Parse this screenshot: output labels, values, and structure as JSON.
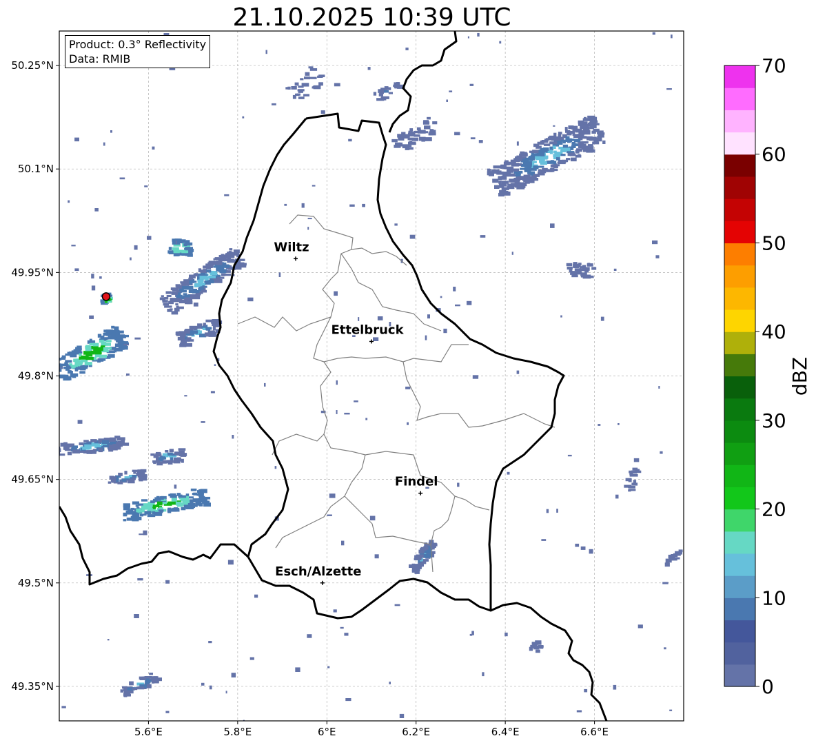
{
  "title": "21.10.2025 10:39 UTC",
  "info_box": {
    "product": "Product: 0.3° Reflectivity",
    "data": "Data: RMIB"
  },
  "map": {
    "lon_range": [
      5.4,
      6.8
    ],
    "lat_range": [
      49.3,
      50.3
    ],
    "x_ticks": [
      "5.6°E",
      "5.8°E",
      "6°E",
      "6.2°E",
      "6.4°E",
      "6.6°E"
    ],
    "x_tick_values": [
      5.6,
      5.8,
      6.0,
      6.2,
      6.4,
      6.6
    ],
    "y_ticks": [
      "49.35°N",
      "49.5°N",
      "49.65°N",
      "49.8°N",
      "49.95°N",
      "50.1°N",
      "50.25°N"
    ],
    "y_tick_values": [
      49.35,
      49.5,
      49.65,
      49.8,
      49.95,
      50.1,
      50.25
    ],
    "gridlines": true
  },
  "cities": [
    {
      "name": "Wiltz",
      "lon": 5.93,
      "lat": 49.97
    },
    {
      "name": "Ettelbruck",
      "lon": 6.1,
      "lat": 49.85
    },
    {
      "name": "Findel",
      "lon": 6.21,
      "lat": 49.63
    },
    {
      "name": "Esch/Alzette",
      "lon": 5.99,
      "lat": 49.5
    }
  ],
  "radar_site": {
    "lon": 5.505,
    "lat": 49.915
  },
  "colorbar": {
    "label": "dBZ",
    "ticks": [
      "0",
      "10",
      "20",
      "30",
      "40",
      "50",
      "60",
      "70"
    ],
    "tick_values": [
      0,
      10,
      20,
      30,
      40,
      50,
      60,
      70
    ],
    "colors": [
      "#6473a8",
      "#51629e",
      "#44579b",
      "#4a78b0",
      "#5b9dc8",
      "#66c0db",
      "#66d8c4",
      "#3fd66a",
      "#12c71a",
      "#11b616",
      "#109f12",
      "#0c8b10",
      "#0a7a0f",
      "#09600b",
      "#467a0a",
      "#afb00a",
      "#fed500",
      "#fdb700",
      "#fd9e00",
      "#fd7e00",
      "#e40303",
      "#c40303",
      "#a00303",
      "#7a0000",
      "#ffe2ff",
      "#ffb3ff",
      "#ff6cff",
      "#ee32ee"
    ]
  },
  "colors": {
    "border": "#000000",
    "canton": "#808080",
    "grid": "#b0b0b0",
    "radar_site": "#e0141c"
  }
}
